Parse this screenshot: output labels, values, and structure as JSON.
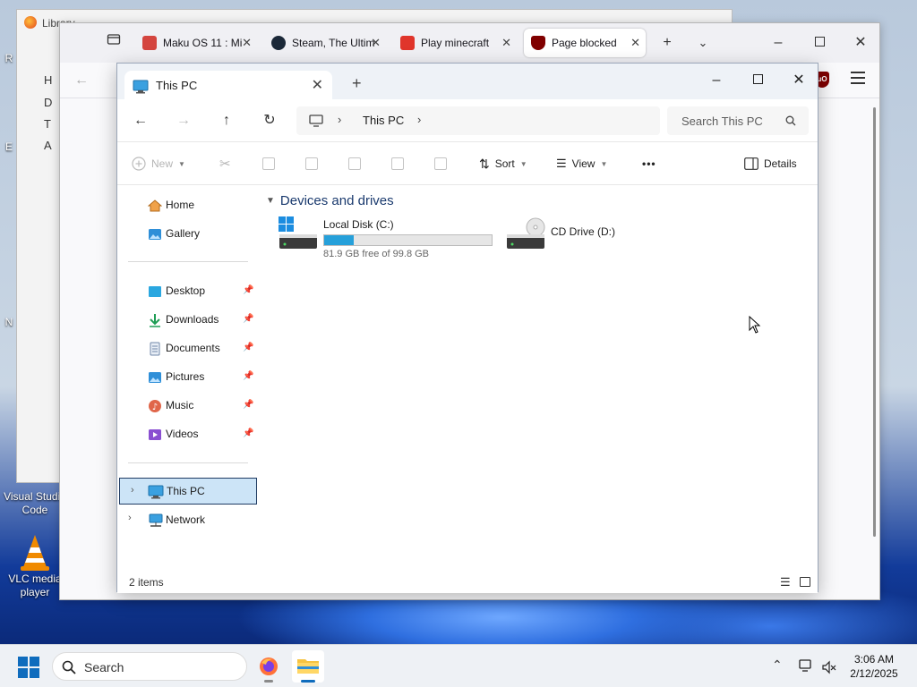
{
  "desktop": {
    "icons": [
      {
        "label": "Visual Studio Code"
      },
      {
        "label": "VLC media player"
      }
    ],
    "left_letters": [
      "R",
      "E",
      "N"
    ]
  },
  "library_window": {
    "title": "Library",
    "sidebar_letters": [
      "H",
      "D",
      "T",
      "A"
    ]
  },
  "browser": {
    "tabs": [
      {
        "label": "Maku OS 11 : Mi",
        "favicon_color": "#d4453f",
        "active": false
      },
      {
        "label": "Steam, The Ultim",
        "favicon_color": "#1b2838",
        "active": false
      },
      {
        "label": "Play minecraft",
        "favicon_color": "#e0352b",
        "active": false
      },
      {
        "label": "Page blocked",
        "favicon_color": "#800000",
        "active": true
      }
    ],
    "extension_badge": "uO"
  },
  "explorer": {
    "tab_title": "This PC",
    "address": {
      "crumb": "This PC"
    },
    "search": {
      "placeholder": "Search This PC"
    },
    "commands": {
      "new": "New",
      "sort": "Sort",
      "view": "View",
      "more": "•••",
      "details": "Details"
    },
    "sidebar": {
      "quick": [
        {
          "label": "Home",
          "icon": "home-icon"
        },
        {
          "label": "Gallery",
          "icon": "gallery-icon"
        }
      ],
      "pinned": [
        {
          "label": "Desktop",
          "icon": "desktop-folder-icon"
        },
        {
          "label": "Downloads",
          "icon": "downloads-icon"
        },
        {
          "label": "Documents",
          "icon": "documents-icon"
        },
        {
          "label": "Pictures",
          "icon": "pictures-icon"
        },
        {
          "label": "Music",
          "icon": "music-icon"
        },
        {
          "label": "Videos",
          "icon": "videos-icon"
        }
      ],
      "locations": [
        {
          "label": "This PC",
          "icon": "this-pc-icon",
          "selected": true
        },
        {
          "label": "Network",
          "icon": "network-icon",
          "selected": false
        }
      ]
    },
    "group_title": "Devices and drives",
    "drives": [
      {
        "name": "Local Disk (C:)",
        "free_text": "81.9 GB free of 99.8 GB",
        "used_fraction": 0.179
      },
      {
        "name": "CD Drive (D:)"
      }
    ],
    "status": {
      "item_count": "2 items"
    }
  },
  "taskbar": {
    "search_text": "Search",
    "time": "3:06 AM",
    "date": "2/12/2025"
  },
  "colors": {
    "accent": "#0f6cbd",
    "selection": "#cce4f7",
    "drive_bar": "#26a0da",
    "ublock": "#800000"
  }
}
